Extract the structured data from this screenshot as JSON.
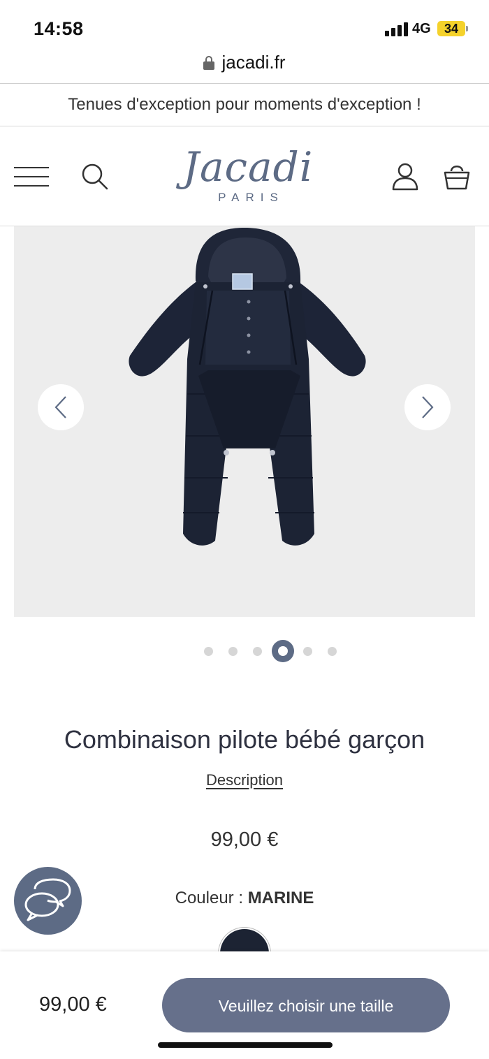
{
  "status_bar": {
    "time": "14:58",
    "network": "4G",
    "battery": "34"
  },
  "browser": {
    "url": "jacadi.fr"
  },
  "promo_banner": {
    "text": "Tenues d'exception pour moments d'exception !"
  },
  "header": {
    "logo_main": "Jacadi",
    "logo_sub": "PARIS"
  },
  "icons": {
    "menu": "hamburger-menu-icon",
    "search": "search-icon",
    "account": "account-icon",
    "cart": "shopping-bag-icon",
    "prev": "chevron-left-icon",
    "next": "chevron-right-icon",
    "chat": "chat-bubbles-icon",
    "lock": "lock-icon"
  },
  "gallery": {
    "total_images": 6,
    "active_index": 4
  },
  "product": {
    "title": "Combinaison pilote bébé garçon",
    "description_link": "Description",
    "price": "99,00 €",
    "color_label": "Couleur : ",
    "color_value": "MARINE",
    "swatch_color": "#1c2333"
  },
  "sticky_bar": {
    "price": "99,00 €",
    "cta_label": "Veuillez choisir une taille"
  },
  "colors": {
    "brand": "#5d6b85",
    "cta": "#66708b"
  }
}
